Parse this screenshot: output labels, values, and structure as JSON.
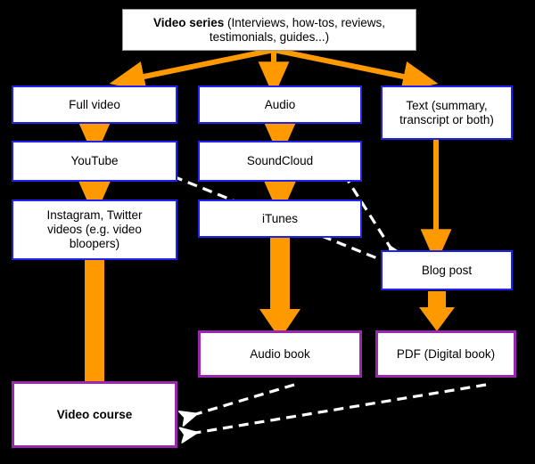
{
  "diagram": {
    "title_box": {
      "strong_text": "Video series",
      "rest_text": " (Interviews, how-tos, reviews, testimonials, guides...)"
    },
    "colors": {
      "background": "#000000",
      "box_fill": "#ffffff",
      "blue_border": "#2222ee",
      "purple_border": "#9b26b0",
      "orange_arrow": "#ff9900",
      "dashed_arrow": "#ffffff",
      "text": "#000000"
    },
    "nodes": [
      {
        "id": "video-series",
        "label": "Video series (Interviews, how-tos, reviews, testimonials, guides...)",
        "border": "gray"
      },
      {
        "id": "full-video",
        "label": "Full video",
        "border": "blue"
      },
      {
        "id": "audio",
        "label": "Audio",
        "border": "blue"
      },
      {
        "id": "text-summary",
        "label": "Text (summary, transcript or both)",
        "border": "blue"
      },
      {
        "id": "youtube",
        "label": "YouTube",
        "border": "blue"
      },
      {
        "id": "soundcloud",
        "label": "SoundCloud",
        "border": "blue"
      },
      {
        "id": "instagram-twitter",
        "label": "Instagram, Twitter videos (e.g. video bloopers)",
        "border": "blue"
      },
      {
        "id": "itunes",
        "label": "iTunes",
        "border": "blue"
      },
      {
        "id": "blog-post",
        "label": "Blog post",
        "border": "blue"
      },
      {
        "id": "audio-book",
        "label": "Audio book",
        "border": "purple"
      },
      {
        "id": "pdf-digital-book",
        "label": "PDF (Digital book)",
        "border": "purple"
      },
      {
        "id": "video-course",
        "label": "Video course",
        "border": "purple"
      }
    ],
    "labels": {
      "full_video": "Full video",
      "audio": "Audio",
      "text_summary_line1": "Text (summary,",
      "text_summary_line2": "transcript or both)",
      "youtube": "YouTube",
      "soundcloud": "SoundCloud",
      "instagram_line1": "Instagram, Twitter",
      "instagram_line2": "videos  (e.g. video",
      "instagram_line3": "bloopers)",
      "itunes": "iTunes",
      "blog_post": "Blog post",
      "audio_book": "Audio book",
      "pdf_digital_book": "PDF (Digital book)",
      "video_course": "Video course"
    },
    "edges": [
      {
        "from": "video-series",
        "to": "full-video",
        "style": "solid-orange"
      },
      {
        "from": "video-series",
        "to": "audio",
        "style": "solid-orange"
      },
      {
        "from": "video-series",
        "to": "text-summary",
        "style": "solid-orange"
      },
      {
        "from": "full-video",
        "to": "youtube",
        "style": "solid-orange"
      },
      {
        "from": "youtube",
        "to": "instagram-twitter",
        "style": "solid-orange"
      },
      {
        "from": "instagram-twitter",
        "to": "video-course",
        "style": "solid-orange-thick"
      },
      {
        "from": "audio",
        "to": "soundcloud",
        "style": "solid-orange"
      },
      {
        "from": "soundcloud",
        "to": "itunes",
        "style": "solid-orange"
      },
      {
        "from": "itunes",
        "to": "audio-book",
        "style": "solid-orange-thick"
      },
      {
        "from": "text-summary",
        "to": "blog-post",
        "style": "solid-orange"
      },
      {
        "from": "blog-post",
        "to": "pdf-digital-book",
        "style": "solid-orange-thick"
      },
      {
        "from": "youtube",
        "to": "blog-post",
        "style": "dashed-white"
      },
      {
        "from": "soundcloud",
        "to": "blog-post",
        "style": "dashed-white"
      },
      {
        "from": "audio-book",
        "to": "video-course",
        "style": "dashed-white"
      },
      {
        "from": "pdf-digital-book",
        "to": "video-course",
        "style": "dashed-white"
      }
    ]
  }
}
